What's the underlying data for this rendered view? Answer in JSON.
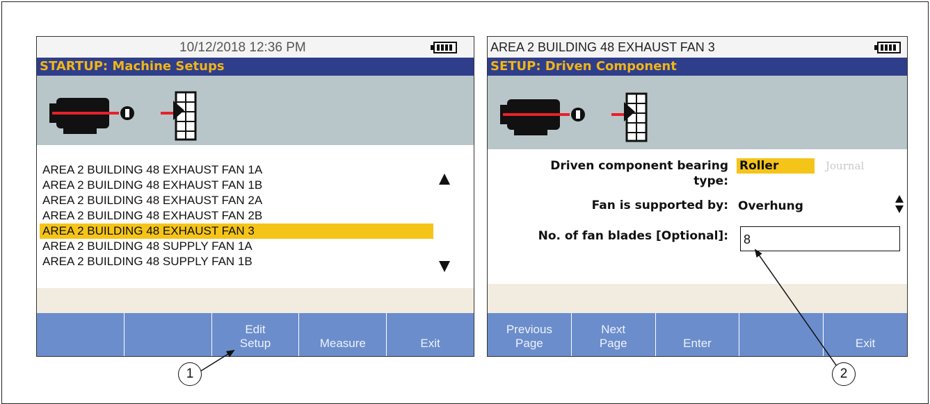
{
  "left_screen": {
    "datetime": "10/12/2018 12:36 PM",
    "title": "STARTUP: Machine Setups",
    "list_items": [
      "AREA 2 BUILDING 48 EXHAUST FAN 1A",
      "AREA 2 BUILDING 48 EXHAUST FAN 1B",
      "AREA 2 BUILDING 48 EXHAUST FAN 2A",
      "AREA 2 BUILDING 48 EXHAUST FAN 2B",
      "AREA 2 BUILDING 48 EXHAUST FAN 3",
      "AREA 2 BUILDING 48 SUPPLY FAN 1A",
      "AREA 2 BUILDING 48 SUPPLY FAN 1B"
    ],
    "selected_index": 4,
    "softkeys": {
      "k1": "",
      "k2": "",
      "k3_line1": "Edit",
      "k3_line2": "Setup",
      "k4": "Measure",
      "k5": "Exit"
    }
  },
  "right_screen": {
    "machine_name": "AREA 2 BUILDING 48 EXHAUST FAN 3",
    "title": "SETUP: Driven Component",
    "bearing_label_line1": "Driven component bearing",
    "bearing_label_line2": "type:",
    "bearing_option_selected": "Roller",
    "bearing_option_other": "Journal",
    "support_label": "Fan is supported by:",
    "support_value": "Overhung",
    "blades_label": "No. of fan blades [Optional]:",
    "blades_value": "8",
    "softkeys": {
      "k1_line1": "Previous",
      "k1_line2": "Page",
      "k2_line1": "Next",
      "k2_line2": "Page",
      "k3": "Enter",
      "k4": "",
      "k5": "Exit"
    }
  },
  "callouts": {
    "one": "1",
    "two": "2"
  },
  "colors": {
    "title_bar_bg": "#2e3e8a",
    "title_text": "#f2b517",
    "highlight": "#f5c419",
    "softkey_bg": "#6b8dcc",
    "diagram_bg": "#b9c6c9",
    "shaft_red": "#e8202a"
  }
}
